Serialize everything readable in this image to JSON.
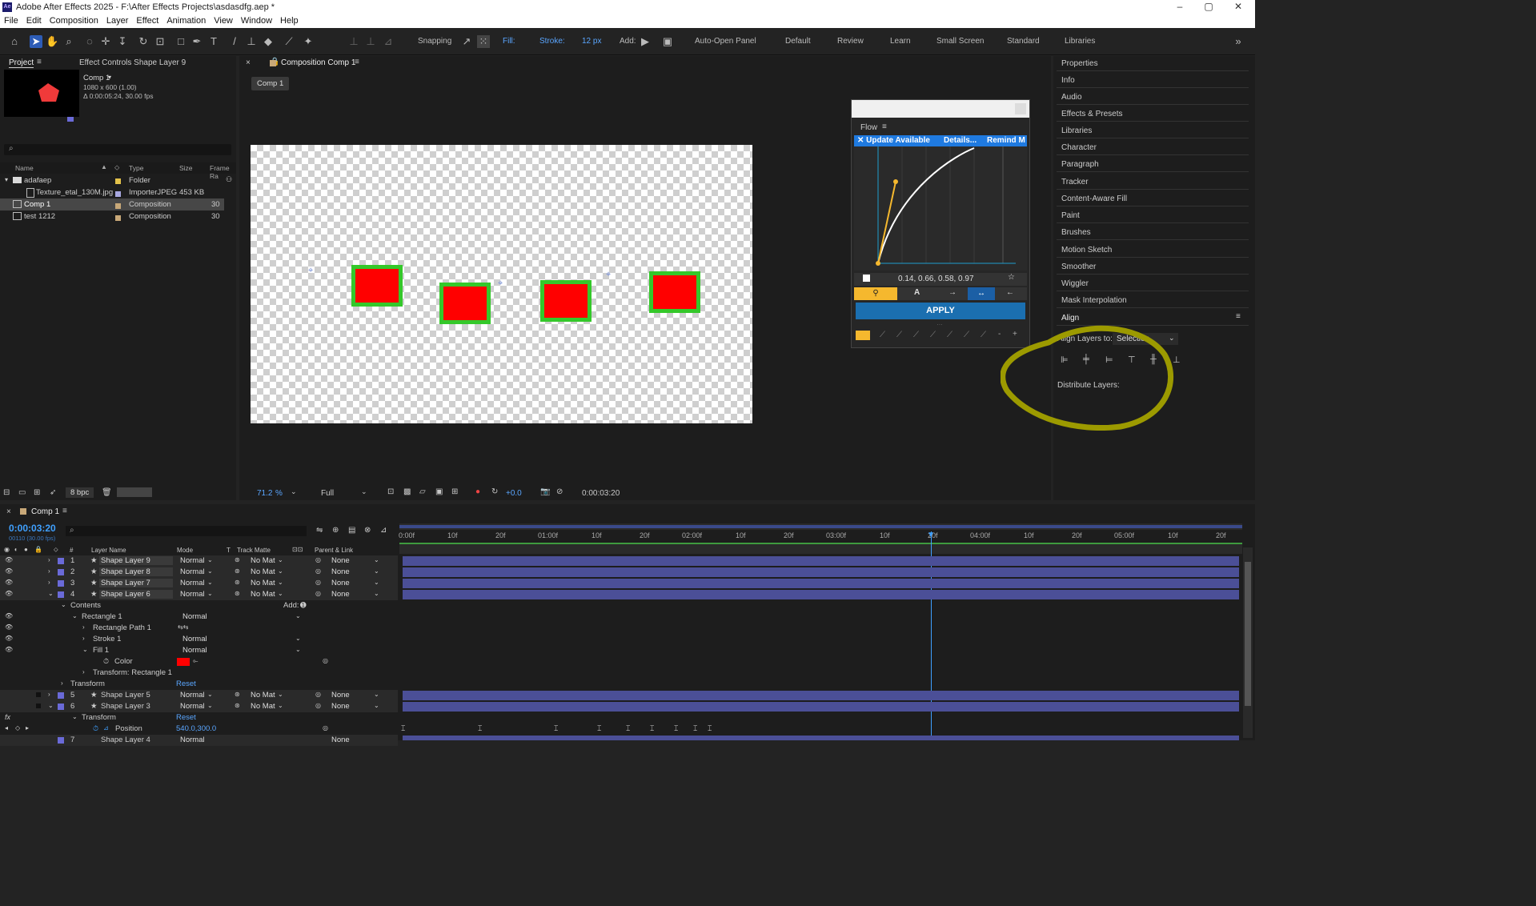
{
  "window": {
    "title": "Adobe After Effects 2025 - F:\\After Effects Projects\\asdasdfg.aep *",
    "logo": "Ae"
  },
  "menu": [
    "File",
    "Edit",
    "Composition",
    "Layer",
    "Effect",
    "Animation",
    "View",
    "Window",
    "Help"
  ],
  "toolbar": {
    "snapping_label": "Snapping",
    "fill_label": "Fill:",
    "stroke_label": "Stroke:",
    "stroke_width": "12 px",
    "add_label": "Add:",
    "auto_open_label": "Auto-Open Panel",
    "workspaces": [
      "Default",
      "Review",
      "Learn",
      "Small Screen",
      "Standard",
      "Libraries"
    ],
    "fill_color": "#ff0000",
    "stroke_color": "#34c82a"
  },
  "project": {
    "tab_project": "Project",
    "tab_effect_controls": "Effect Controls Shape Layer 9",
    "preview_name": "Comp 1",
    "preview_size": "1080 x 600 (1.00)",
    "preview_duration": "Δ 0:00:05:24, 30.00 fps",
    "search_placeholder": "",
    "columns": [
      "Name",
      "Type",
      "Size",
      "Frame Ra"
    ],
    "items": [
      {
        "name": "adafaep",
        "type": "Folder",
        "size": "",
        "fps": "",
        "color": "#e3c24a"
      },
      {
        "name": "Texture_etal_130M.jpg",
        "type": "ImporterJPEG",
        "size": "453 KB",
        "fps": "",
        "color": "#a8a8e0"
      },
      {
        "name": "Comp 1",
        "type": "Composition",
        "size": "",
        "fps": "30",
        "color": "#c8a878"
      },
      {
        "name": "test 1212",
        "type": "Composition",
        "size": "",
        "fps": "30",
        "color": "#c8a878"
      }
    ],
    "bpc": "8 bpc"
  },
  "viewer": {
    "tab": "Composition Comp 1",
    "breadcrumb": "Comp 1",
    "zoom": "71.2",
    "zoom_unit": "%",
    "resolution": "Full",
    "exposure": "+0.0",
    "timecode": "0:00:03:20"
  },
  "flow": {
    "title": "Flow",
    "update_text": "✕ Update Available",
    "details": "Details...",
    "remind": "Remind M",
    "values": "0.14, 0.66, 0.58, 0.97",
    "apply": "APPLY",
    "minus": "-",
    "plus": "+"
  },
  "right_panel": {
    "items": [
      "Properties",
      "Info",
      "Audio",
      "Effects & Presets",
      "Libraries",
      "Character",
      "Paragraph",
      "Tracker",
      "Content-Aware Fill",
      "Paint",
      "Brushes",
      "Motion Sketch",
      "Smoother",
      "Wiggler",
      "Mask Interpolation"
    ],
    "align_title": "Align",
    "align_to_label": "Align Layers to:",
    "align_to_value": "Selection",
    "distribute_label": "Distribute Layers:"
  },
  "timeline": {
    "tab": "Comp 1",
    "timecode": "0:00:03:20",
    "frame_info": "00110 (30.00 fps)",
    "col_layer_name": "Layer Name",
    "col_mode": "Mode",
    "col_t": "T",
    "col_track_matte": "Track Matte",
    "col_parent": "Parent & Link",
    "col_hash": "#",
    "ruler": [
      "0:00f",
      "10f",
      "20f",
      "01:00f",
      "10f",
      "20f",
      "02:00f",
      "10f",
      "20f",
      "03:00f",
      "10f",
      "20f",
      "04:00f",
      "10f",
      "20f",
      "05:00f",
      "10f",
      "20f"
    ],
    "layers": [
      {
        "num": "1",
        "name": "Shape Layer 9",
        "mode": "Normal",
        "matte": "No Mat",
        "parent": "None"
      },
      {
        "num": "2",
        "name": "Shape Layer 8",
        "mode": "Normal",
        "matte": "No Mat",
        "parent": "None"
      },
      {
        "num": "3",
        "name": "Shape Layer 7",
        "mode": "Normal",
        "matte": "No Mat",
        "parent": "None"
      },
      {
        "num": "4",
        "name": "Shape Layer 6",
        "mode": "Normal",
        "matte": "No Mat",
        "parent": "None"
      }
    ],
    "contents_label": "Contents",
    "add_label": "Add:",
    "rect1": "Rectangle 1",
    "rect1_mode": "Normal",
    "rect_path": "Rectangle Path 1",
    "stroke1": "Stroke 1",
    "stroke1_mode": "Normal",
    "fill1": "Fill 1",
    "fill1_mode": "Normal",
    "color_label": "Color",
    "transform_rect": "Transform: Rectangle 1",
    "transform": "Transform",
    "reset": "Reset",
    "layers2": [
      {
        "num": "5",
        "name": "Shape Layer 5",
        "mode": "Normal",
        "matte": "No Mat",
        "parent": "None"
      },
      {
        "num": "6",
        "name": "Shape Layer 3",
        "mode": "Normal",
        "matte": "No Mat",
        "parent": "None"
      }
    ],
    "transform2": "Transform",
    "reset2": "Reset",
    "position_label": "Position",
    "position_value": "540.0,300.0",
    "layer7": {
      "num": "7",
      "name": "Shape Layer 4",
      "mode": "Normal",
      "parent": "None"
    }
  }
}
